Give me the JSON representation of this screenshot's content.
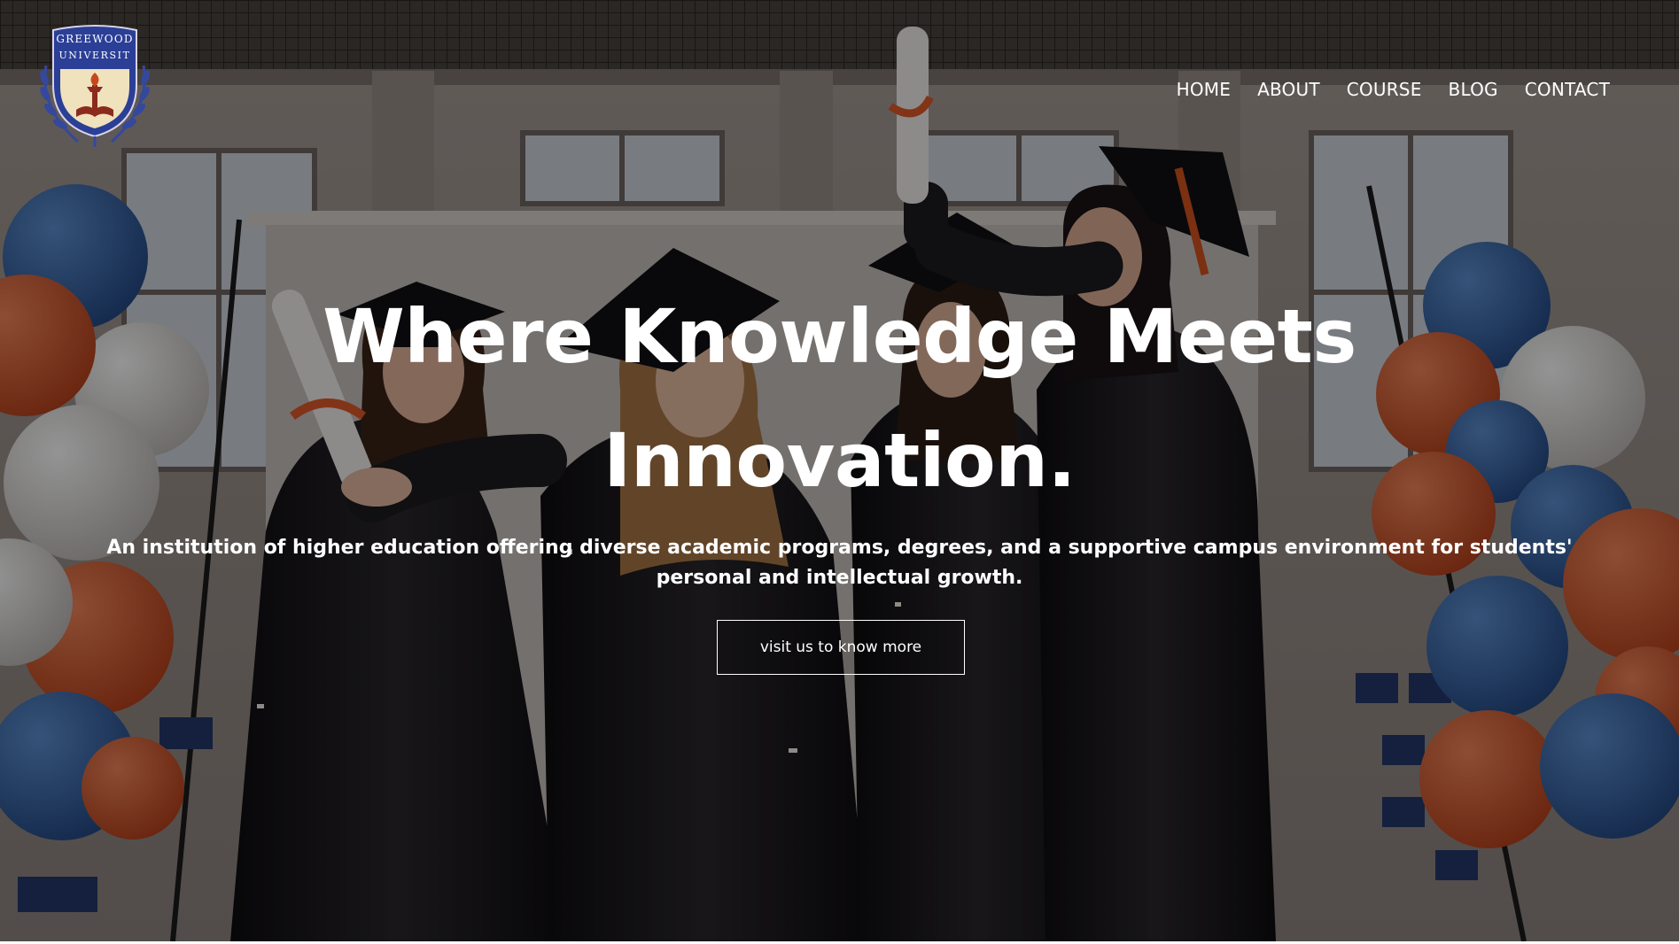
{
  "logo": {
    "line1": "GREEWOOD",
    "line2": "UNIVERSIT"
  },
  "nav": {
    "items": [
      {
        "label": "HOME"
      },
      {
        "label": "ABOUT"
      },
      {
        "label": "COURSE"
      },
      {
        "label": "BLOG"
      },
      {
        "label": "CONTACT"
      }
    ]
  },
  "hero": {
    "headline_line1": "Where Knowledge Meets",
    "headline_line2": "Innovation.",
    "subtitle": "An institution of higher education offering diverse academic programs, degrees, and a supportive campus environment for students' personal and intellectual growth.",
    "cta_label": "visit us to know more"
  },
  "colors": {
    "crest_blue": "#2b3f97",
    "crest_cream": "#efe2bd",
    "balloon_orange": "#d8562b",
    "balloon_blue": "#3b67a8",
    "balloon_white": "#e6e4e2",
    "gown": "#151316"
  }
}
